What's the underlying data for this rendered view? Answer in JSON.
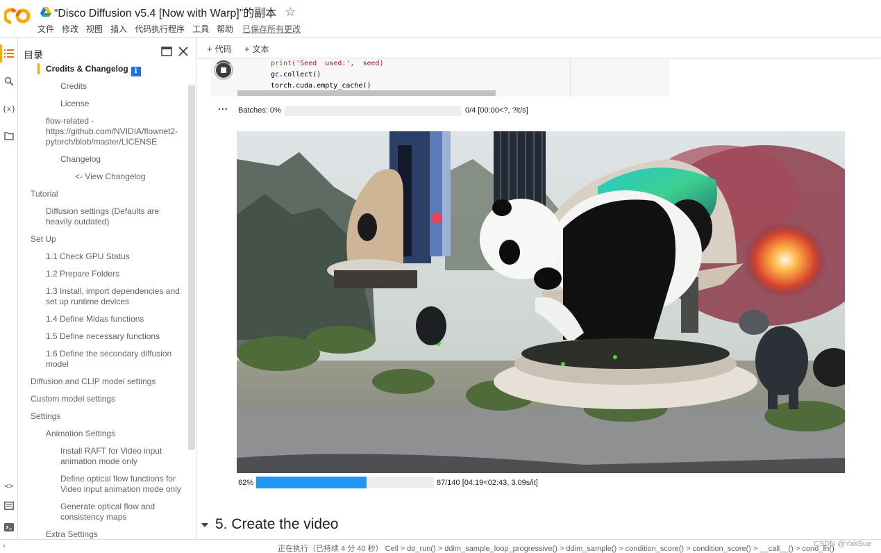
{
  "app": {
    "notebook_title": "“Disco Diffusion v5.4 [Now with Warp]”的副本",
    "menu": [
      "文件",
      "修改",
      "视图",
      "插入",
      "代码执行程序",
      "工具",
      "帮助"
    ],
    "saved_status": "已保存所有更改",
    "logo_text": "CO"
  },
  "toc": {
    "title": "目录",
    "items": [
      {
        "label": "Credits & Changelog",
        "level": 1
      },
      {
        "label": "Credits",
        "level": 2
      },
      {
        "label": "License",
        "level": 2
      },
      {
        "label": "flow-related -\nhttps://github.com/NVIDIA/flownet2-\npytorch/blob/master/LICENSE",
        "level": 1
      },
      {
        "label": "Changelog",
        "level": 2
      },
      {
        "label": "<- View Changelog",
        "level": 3
      },
      {
        "label": "Tutorial",
        "level": 0
      },
      {
        "label": "Diffusion settings (Defaults are\nheavily outdated)",
        "level": 1
      },
      {
        "label": "Set Up",
        "level": 0
      },
      {
        "label": "1.1 Check GPU Status",
        "level": 1
      },
      {
        "label": "1.2 Prepare Folders",
        "level": 1
      },
      {
        "label": "1.3 Install, import dependencies and\nset up runtime devices",
        "level": 1
      },
      {
        "label": "1.4 Define Midas functions",
        "level": 1
      },
      {
        "label": "1.5 Define necessary functions",
        "level": 1
      },
      {
        "label": "1.6 Define the secondary diffusion\nmodel",
        "level": 1
      },
      {
        "label": "Diffusion and CLIP model settings",
        "level": 0
      },
      {
        "label": "Custom model settings",
        "level": 0
      },
      {
        "label": "Settings",
        "level": 0
      },
      {
        "label": "Animation Settings",
        "level": 1
      },
      {
        "label": "Install RAFT for Video input\nanimation mode only",
        "level": 2
      },
      {
        "label": "Define optical flow functions for\nVideo input animation mode only",
        "level": 2
      },
      {
        "label": "Generate optical flow and\nconsistency maps",
        "level": 2
      },
      {
        "label": "Extra Settings",
        "level": 1
      }
    ]
  },
  "toolbar": {
    "add_code": "代码",
    "add_text": "文本"
  },
  "code": {
    "line1_fn": "print",
    "line1_str": "('Seed  used:',  seed)",
    "line2": "gc.collect()",
    "line3": "torch.cuda.empty_cache()"
  },
  "output": {
    "menu_dots": "...",
    "batches_label": "Batches: 0%",
    "batches_progress": 0,
    "batches_stats": "0/4 [00:00<?, ?it/s]",
    "progress_label": "62%",
    "progress_fraction": 0.62,
    "progress_stats": "87/140 [04:19<02:43, 3.09s/it]"
  },
  "section": {
    "title": "5. Create the video"
  },
  "status": {
    "text": "正在执行（已持续 4 分 40 秒）   Cell  >  do_run()  >  ddim_sample_loop_progressive()  >  ddim_sample()  >  condition_score()  >  condition_score()  >  __call__()  >  cond_fn()",
    "watermark": "CSDN @YakSue"
  },
  "colors": {
    "accent_orange": "#f9ab00",
    "progress_blue": "#2196f3",
    "info_blue": "#1a73e8"
  }
}
